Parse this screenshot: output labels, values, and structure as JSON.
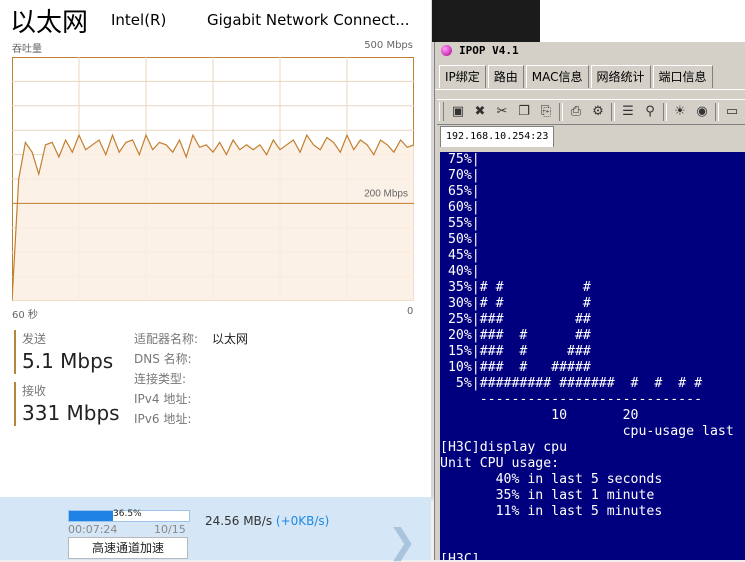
{
  "task_manager": {
    "title": "以太网",
    "brand": "Intel(R)",
    "adapter": "Gigabit Network Connect...",
    "throughput_label": "吞吐量",
    "max_scale": "500 Mbps",
    "mid_scale": "200 Mbps",
    "x_left": "60 秒",
    "x_right": "0",
    "send": {
      "label": "发送",
      "value": "5.1 Mbps"
    },
    "receive": {
      "label": "接收",
      "value": "331 Mbps"
    },
    "properties": [
      {
        "key": "适配器名称:",
        "value": "以太网"
      },
      {
        "key": "DNS 名称:",
        "value": ""
      },
      {
        "key": "连接类型:",
        "value": ""
      },
      {
        "key": "IPv4 地址:",
        "value": ""
      },
      {
        "key": "IPv6 地址:",
        "value": ""
      }
    ],
    "colors": {
      "line": "#c17f2f",
      "fill": "#fbeee2",
      "grid": "#e8d5c0",
      "accent": "#b8863b"
    }
  },
  "chart_data": {
    "type": "area",
    "ylim": [
      0,
      500
    ],
    "gridlines": true,
    "series": [
      {
        "values": [
          0,
          250,
          325,
          305,
          260,
          320,
          325,
          295,
          330,
          305,
          340,
          310,
          320,
          330,
          300,
          340,
          305,
          325,
          330,
          300,
          340,
          310,
          325,
          320,
          305,
          330,
          295,
          340,
          315,
          320,
          305,
          325,
          300,
          330,
          310,
          320,
          310,
          320,
          300,
          330,
          310,
          320,
          330,
          305,
          340,
          320,
          310,
          335,
          325,
          305,
          340,
          310,
          330,
          320,
          300,
          330,
          320,
          305,
          330,
          315,
          320
        ]
      }
    ]
  },
  "download": {
    "percent_text": "36.5%",
    "percent_value": 0.365,
    "elapsed": "00:07:24",
    "count": "10/15",
    "speed": "24.56",
    "speed_unit": "MB/s",
    "speed_up": "(+0KB/s)",
    "accelerate_label": "高速通道加速"
  },
  "ipop": {
    "title": "IPOP V4.1",
    "tabs": [
      "IP绑定",
      "路由",
      "MAC信息",
      "网络统计",
      "端口信息"
    ],
    "session_tab": "192.168.10.254:23",
    "toolbar_icons": [
      "new-session-icon",
      "delete-icon",
      "cut-icon",
      "copy-icon",
      "paste-icon",
      "print-icon",
      "settings-icon",
      "book-icon",
      "find-icon",
      "sun-icon",
      "record-icon",
      "menu-icon"
    ],
    "terminal_lines": [
      " 75%|",
      " 70%|",
      " 65%|",
      " 60%|",
      " 55%|",
      " 50%|",
      " 45%|",
      " 40%|",
      " 35%|# #          #",
      " 30%|# #          #",
      " 25%|###         ##",
      " 20%|###  #      ##",
      " 15%|###  #     ###",
      " 10%|###  #   #####",
      "  5%|######### #######  #  #  # #",
      "     ----------------------------",
      "              10       20",
      "                       cpu-usage last",
      "[H3C]display cpu",
      "Unit CPU usage:",
      "       40% in last 5 seconds",
      "       35% in last 1 minute",
      "       11% in last 5 minutes",
      "",
      ""
    ],
    "prompt": "[H3C]"
  }
}
